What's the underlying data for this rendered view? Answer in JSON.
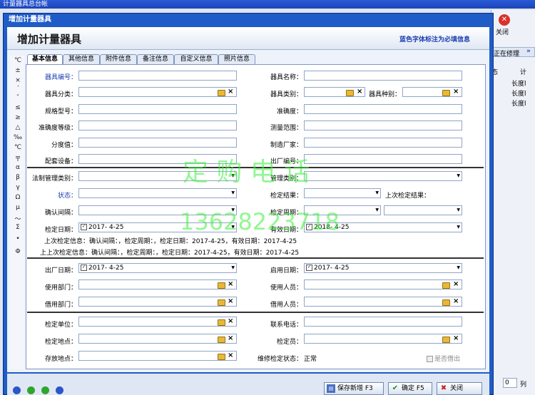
{
  "window": {
    "title": "计量器具总台帐"
  },
  "dialog": {
    "title": "增加计量器具",
    "heading": "增加计量器具",
    "hint": "蓝色字体标注为必填信息"
  },
  "symbols": [
    "℃",
    "±",
    "×",
    "ˊ",
    "″",
    "≤",
    "≥",
    "△",
    "‰",
    "℃",
    "〒",
    "α",
    "β",
    "γ",
    "Ω",
    "μ",
    "～",
    "Σ",
    "•",
    "Φ"
  ],
  "tabs": [
    "基本信息",
    "其他信息",
    "附件信息",
    "备注信息",
    "自定义信息",
    "照片信息"
  ],
  "form": {
    "labels": {
      "id": "器具编号：",
      "name": "器具名称：",
      "category": "器具分类：",
      "type": "器具类别：",
      "kind": "器具种别：",
      "model": "规格型号：",
      "accuracy": "准确度：",
      "accuracy_grade": "准确度等级：",
      "range": "测量范围：",
      "resolution": "分度值：",
      "manufacturer": "制造厂家：",
      "accessory": "配套设备：",
      "serial": "出厂编号：",
      "legal_type": "法制管理类别：",
      "mgmt_type": "管理类别：",
      "status": "状态：",
      "check_result": "检定结果：",
      "last_result": "上次检定结果：",
      "confirm_interval": "确认间隔：",
      "check_period": "检定周期：",
      "check_date": "检定日期：",
      "valid_date": "有效日期：",
      "factory_date": "出厂日期：",
      "enable_date": "启用日期：",
      "use_dept": "使用部门：",
      "use_person": "使用人员：",
      "borrow_dept": "借用部门：",
      "borrow_person": "借用人员：",
      "check_unit": "检定单位：",
      "phone": "联系电话：",
      "check_place": "检定地点：",
      "inspector": "检定员：",
      "storage": "存放地点：",
      "repair_status": "维修检定状态："
    },
    "values": {
      "check_date": "2017- 4-25",
      "valid_date": "2018- 4-25",
      "factory_date": "2017- 4-25",
      "enable_date": "2017- 4-25",
      "repair_status": "正常",
      "borrowed_checkbox": "是否借出"
    },
    "info_line_1": "上次检定信息：确认间隔：，检定周期：，检定日期：2017-4-25，有效日期：2017-4-25",
    "info_line_2": "上上次检定信息：确认间隔：，检定周期：，检定日期：2017-4-25，有效日期：2017-4-25"
  },
  "watermark": {
    "line1": "定 购 电 话",
    "line2": "13628223718"
  },
  "buttons": {
    "save_new": "保存新增 F3",
    "ok": "确定 F5",
    "close": "关闭"
  },
  "right_panel": {
    "close_label": "关闭",
    "status_text": "正在修理",
    "col_header_1": "态",
    "col_header_2": "计",
    "rows": [
      "长度l",
      "长度l",
      "长度l"
    ],
    "stepper_value": "0",
    "stepper_suffix": "列"
  }
}
